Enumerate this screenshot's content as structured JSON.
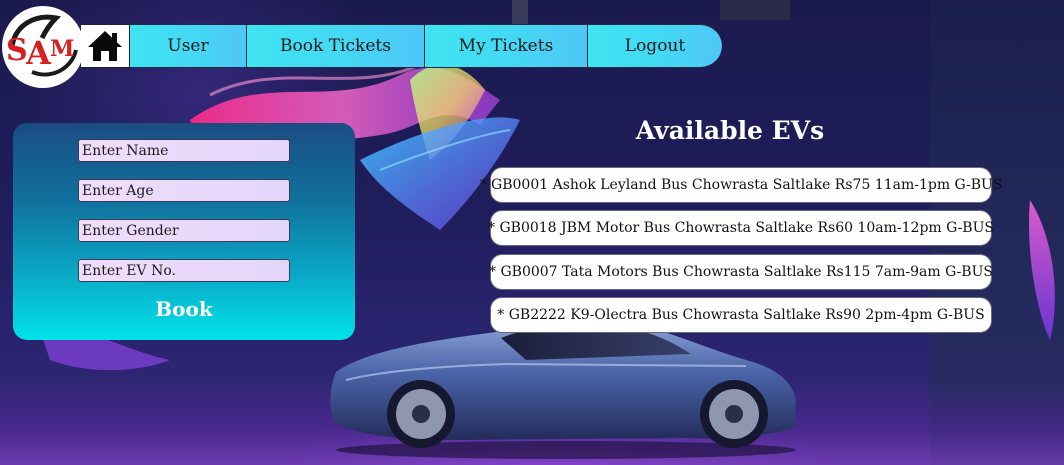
{
  "logo": {
    "icon": "sam-logo"
  },
  "nav": {
    "home_icon": "home-icon",
    "items": [
      {
        "label": "User"
      },
      {
        "label": "Book Tickets"
      },
      {
        "label": "My Tickets"
      },
      {
        "label": "Logout"
      }
    ]
  },
  "booking_form": {
    "fields": [
      {
        "placeholder": "Enter Name",
        "value": ""
      },
      {
        "placeholder": "Enter Age",
        "value": ""
      },
      {
        "placeholder": "Enter Gender",
        "value": ""
      },
      {
        "placeholder": "Enter EV No.",
        "value": ""
      }
    ],
    "submit_label": "Book"
  },
  "ev_list": {
    "title": "Available EVs",
    "items": [
      {
        "text": "* GB0001 Ashok Leyland Bus Chowrasta Saltlake Rs75 11am-1pm G-BUS"
      },
      {
        "text": "* GB0018 JBM Motor Bus Chowrasta Saltlake Rs60 10am-12pm G-BUS"
      },
      {
        "text": "* GB0007 Tata Motors Bus Chowrasta Saltlake Rs115 7am-9am G-BUS"
      },
      {
        "text": "* GB2222 K9-Olectra Bus Chowrasta Saltlake Rs90 2pm-4pm G-BUS"
      }
    ]
  },
  "colors": {
    "nav_gradient_start": "#3fe4f2",
    "panel_gradient_top": "#1a4d82",
    "panel_gradient_bottom": "#00e3e8",
    "background": "#1b1a4e"
  }
}
